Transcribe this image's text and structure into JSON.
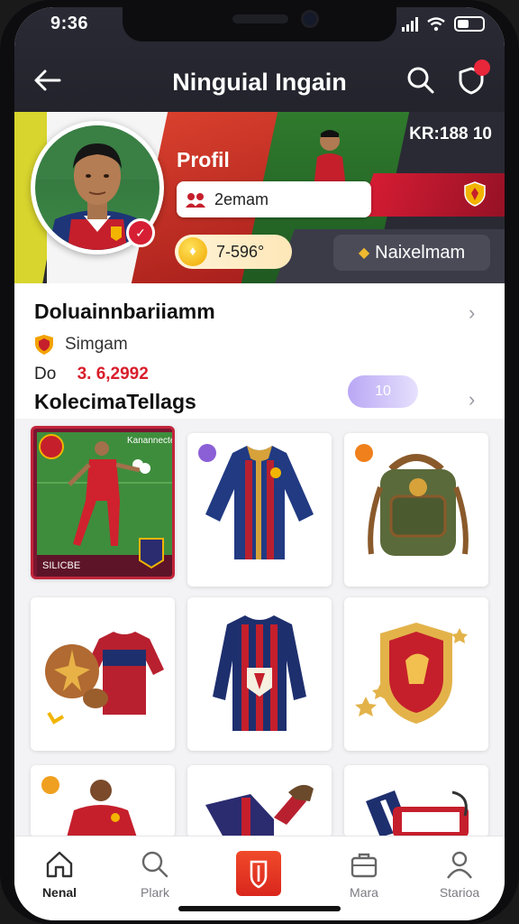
{
  "status": {
    "time": "9:36"
  },
  "header": {
    "title": "Ninguial Ingain"
  },
  "banner": {
    "code": "KR:188 10"
  },
  "profile": {
    "label": "Profil",
    "team": "2emam",
    "coins": "7-596°",
    "rank": "Naixelmam"
  },
  "info": {
    "title": "Doluainnbariiamm",
    "club": "Simgam",
    "value_prefix": "Do",
    "value": "3. 6,2992",
    "collection_title": "KolecimaTellags",
    "collection_badge": "10"
  },
  "collection": {
    "items": [
      {
        "kind": "player-card",
        "label": "Kanannecte",
        "footer": "SILICBE",
        "tag_color": "#c2243b"
      },
      {
        "kind": "jersey-long",
        "tag_color": "#8b5fd6"
      },
      {
        "kind": "backpack",
        "tag_color": "#f0801c"
      },
      {
        "kind": "ball-shirt"
      },
      {
        "kind": "jersey-striped"
      },
      {
        "kind": "crest"
      },
      {
        "kind": "player-photo",
        "tag_color": "#f0a020"
      },
      {
        "kind": "boots-kit"
      },
      {
        "kind": "bag-kit"
      }
    ]
  },
  "tabs": [
    {
      "label": "Nenal",
      "icon": "home-icon",
      "active": true
    },
    {
      "label": "Plark",
      "icon": "search-icon"
    },
    {
      "label": "",
      "icon": "shield-icon"
    },
    {
      "label": "Mara",
      "icon": "briefcase-icon"
    },
    {
      "label": "Starioa",
      "icon": "profile-icon"
    }
  ],
  "colors": {
    "accent": "#d91e2c",
    "dark": "#23232c",
    "coin": "#f0a800"
  }
}
